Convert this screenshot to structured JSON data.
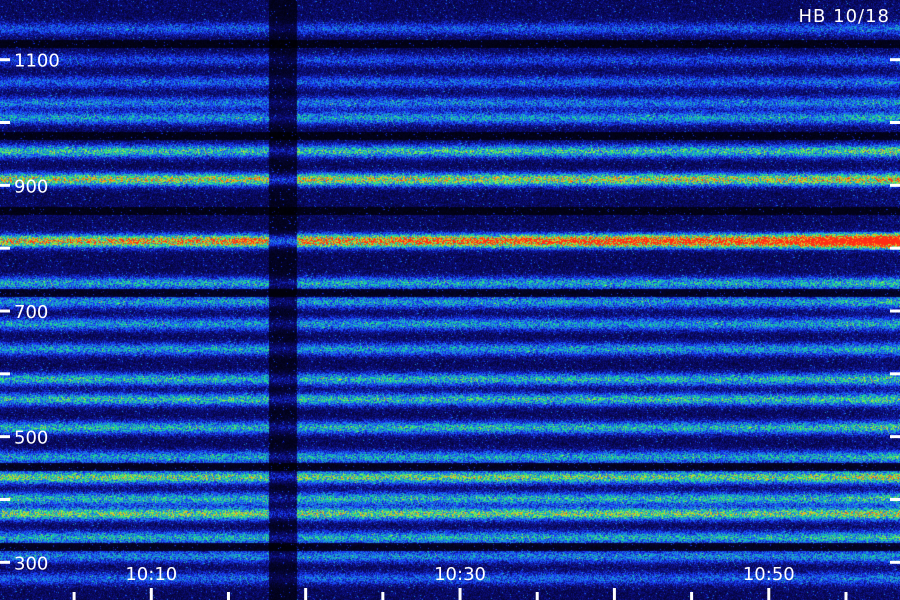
{
  "chart_data": {
    "type": "heatmap",
    "title": "HB 10/18",
    "xlabel": "",
    "ylabel": "",
    "x_tick_labels": [
      "10:10",
      "10:30",
      "10:50"
    ],
    "x_tick_values_minutes": [
      10,
      30,
      50
    ],
    "x_range_minutes": [
      0.2,
      58.5
    ],
    "y_tick_labels": [
      "300",
      "500",
      "700",
      "900",
      "1100"
    ],
    "y_tick_values": [
      300,
      500,
      700,
      900,
      1100
    ],
    "y_minor_tick_values": [
      400,
      600,
      800,
      1000
    ],
    "y_range": [
      240,
      1195
    ],
    "colormap": [
      "#000000",
      "#0a0a6e",
      "#1a3cff",
      "#1e9bd8",
      "#19e28a",
      "#aaf03a",
      "#ffa41a",
      "#ff2b14"
    ],
    "bands": [
      {
        "y": 1150,
        "intensity": 0.18
      },
      {
        "y": 1100,
        "intensity": 0.15
      },
      {
        "y": 1065,
        "intensity": 0.2
      },
      {
        "y": 1032,
        "intensity": 0.24
      },
      {
        "y": 1008,
        "intensity": 0.3
      },
      {
        "y": 955,
        "intensity": 0.4
      },
      {
        "y": 910,
        "intensity": 0.58
      },
      {
        "y": 812,
        "intensity": 0.8
      },
      {
        "y": 745,
        "intensity": 0.33
      },
      {
        "y": 715,
        "intensity": 0.3
      },
      {
        "y": 680,
        "intensity": 0.3
      },
      {
        "y": 640,
        "intensity": 0.3
      },
      {
        "y": 592,
        "intensity": 0.36
      },
      {
        "y": 560,
        "intensity": 0.38
      },
      {
        "y": 515,
        "intensity": 0.36
      },
      {
        "y": 468,
        "intensity": 0.32
      },
      {
        "y": 436,
        "intensity": 0.48
      },
      {
        "y": 402,
        "intensity": 0.36
      },
      {
        "y": 378,
        "intensity": 0.5
      },
      {
        "y": 340,
        "intensity": 0.34
      },
      {
        "y": 310,
        "intensity": 0.26
      },
      {
        "y": 275,
        "intensity": 0.2
      }
    ]
  }
}
